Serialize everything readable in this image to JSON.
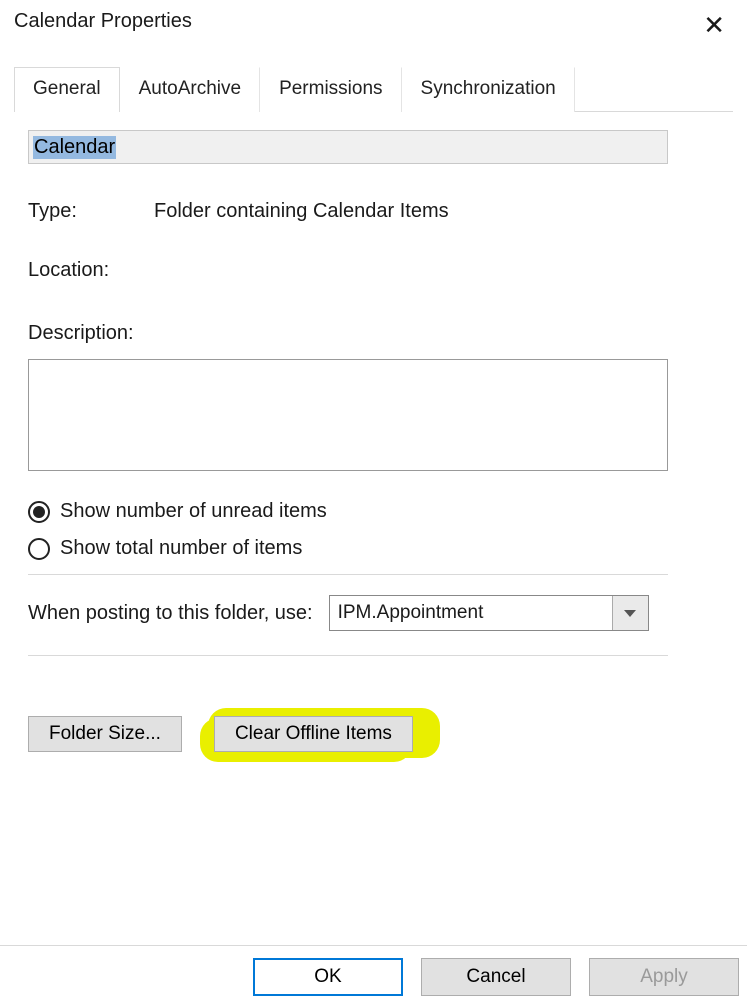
{
  "dialog": {
    "title": "Calendar Properties"
  },
  "tabs": {
    "general": "General",
    "autoarchive": "AutoArchive",
    "permissions": "Permissions",
    "synchronization": "Synchronization"
  },
  "general": {
    "name_value": "Calendar",
    "type_label": "Type:",
    "type_value": "Folder containing Calendar Items",
    "location_label": "Location:",
    "location_value": "",
    "description_label": "Description:",
    "description_value": "",
    "radio_unread": "Show number of unread items",
    "radio_total": "Show total number of items",
    "posting_label": "When posting to this folder, use:",
    "posting_value": "IPM.Appointment",
    "folder_size_btn": "Folder Size...",
    "clear_offline_btn": "Clear Offline Items"
  },
  "buttons": {
    "ok": "OK",
    "cancel": "Cancel",
    "apply": "Apply"
  }
}
